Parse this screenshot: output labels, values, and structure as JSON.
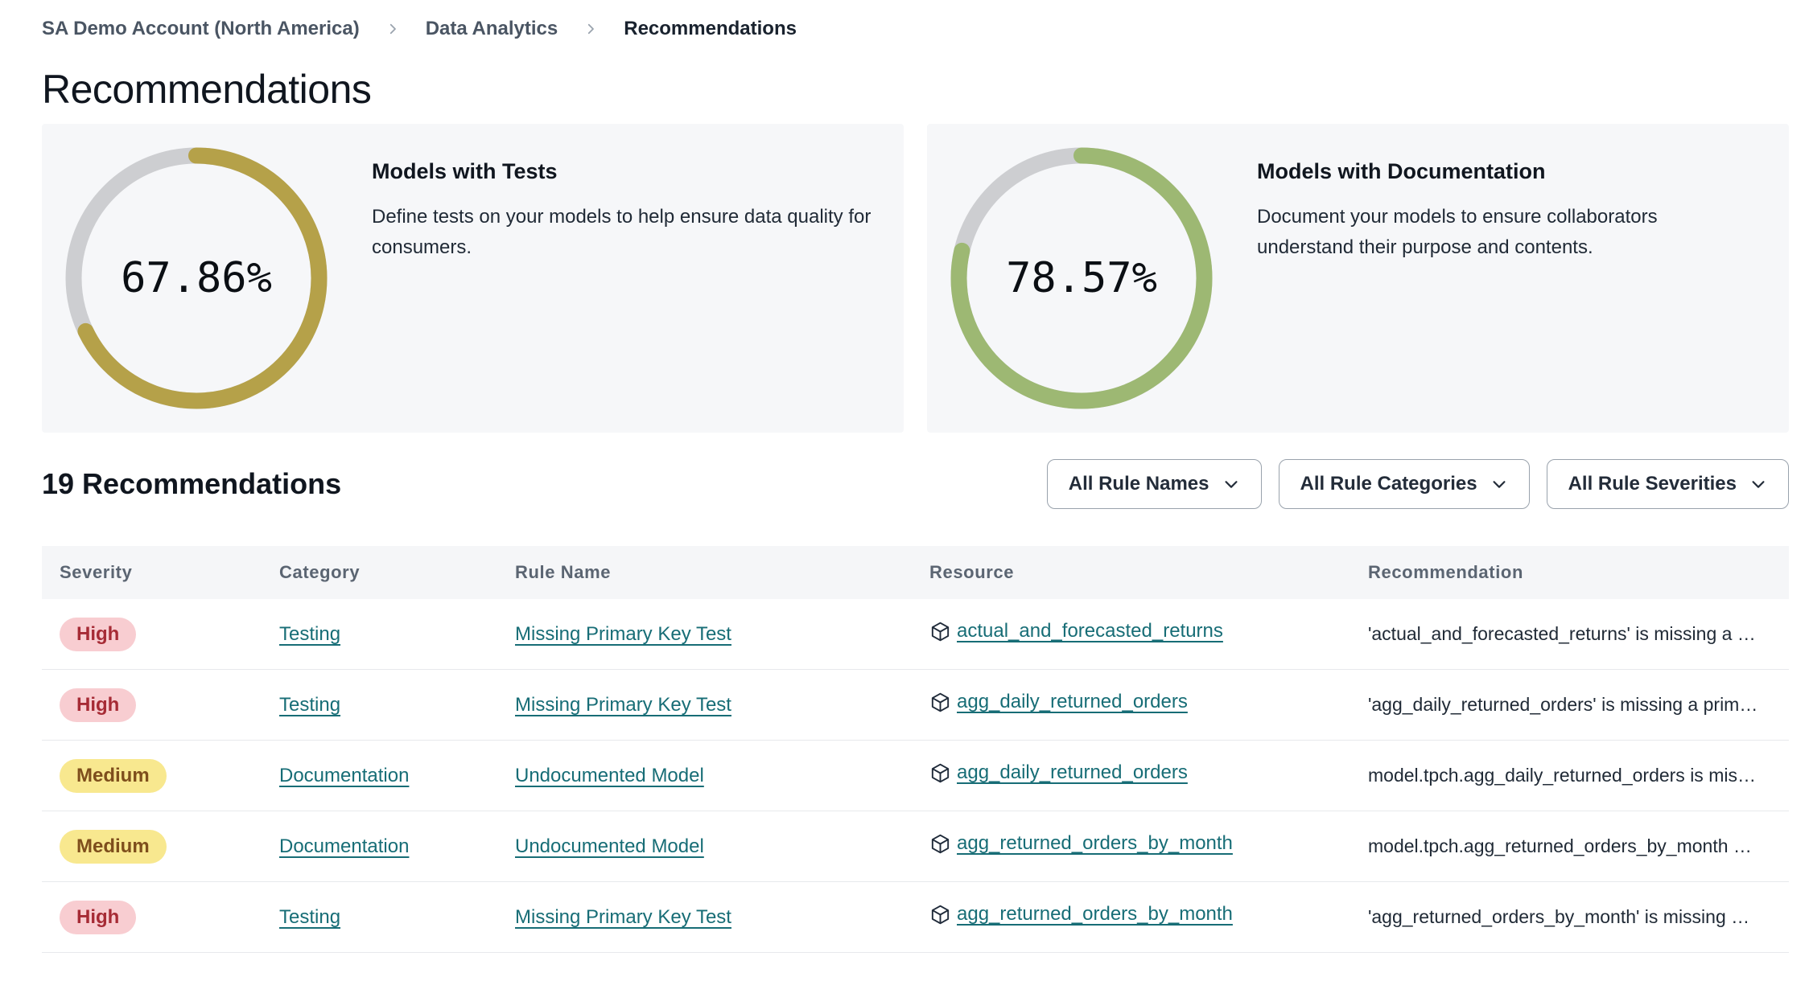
{
  "breadcrumb": {
    "items": [
      {
        "label": "SA Demo Account (North America)"
      },
      {
        "label": "Data Analytics"
      },
      {
        "label": "Recommendations"
      }
    ]
  },
  "page": {
    "title": "Recommendations"
  },
  "chart_data": [
    {
      "type": "donut",
      "title": "Models with Tests",
      "description": "Define tests on your models to help ensure data quality for consumers.",
      "value_pct": 67.86,
      "value_label": "67.86%",
      "ring_color": "#B5A149",
      "track_color": "#CDCED1"
    },
    {
      "type": "donut",
      "title": "Models with Documentation",
      "description": "Document your models to ensure collaborators understand their purpose and contents.",
      "value_pct": 78.57,
      "value_label": "78.57%",
      "ring_color": "#9DB873",
      "track_color": "#CDCED1"
    }
  ],
  "list_header": {
    "title": "19 Recommendations",
    "filters": [
      {
        "label": "All Rule Names"
      },
      {
        "label": "All Rule Categories"
      },
      {
        "label": "All Rule Severities"
      }
    ]
  },
  "table": {
    "columns": [
      "Severity",
      "Category",
      "Rule Name",
      "Resource",
      "Recommendation"
    ],
    "rows": [
      {
        "severity": "High",
        "category": "Testing",
        "rule_name": "Missing Primary Key Test",
        "resource": "actual_and_forecasted_returns",
        "recommendation": "'actual_and_forecasted_returns' is missing a …"
      },
      {
        "severity": "High",
        "category": "Testing",
        "rule_name": "Missing Primary Key Test",
        "resource": "agg_daily_returned_orders",
        "recommendation": "'agg_daily_returned_orders' is missing a prim…"
      },
      {
        "severity": "Medium",
        "category": "Documentation",
        "rule_name": "Undocumented Model",
        "resource": "agg_daily_returned_orders",
        "recommendation": "model.tpch.agg_daily_returned_orders is mis…"
      },
      {
        "severity": "Medium",
        "category": "Documentation",
        "rule_name": "Undocumented Model",
        "resource": "agg_returned_orders_by_month",
        "recommendation": "model.tpch.agg_returned_orders_by_month …"
      },
      {
        "severity": "High",
        "category": "Testing",
        "rule_name": "Missing Primary Key Test",
        "resource": "agg_returned_orders_by_month",
        "recommendation": "'agg_returned_orders_by_month' is missing …"
      }
    ]
  },
  "icons": {
    "breadcrumb_separator": "chevron-right-icon",
    "filter_dropdown": "chevron-down-icon",
    "resource": "cube-icon"
  },
  "colors": {
    "link": "#176D76",
    "severity": {
      "High": {
        "bg": "#F8CDD1",
        "text": "#A62B35"
      },
      "Medium": {
        "bg": "#F8E88F",
        "text": "#7E4E1C"
      }
    }
  }
}
